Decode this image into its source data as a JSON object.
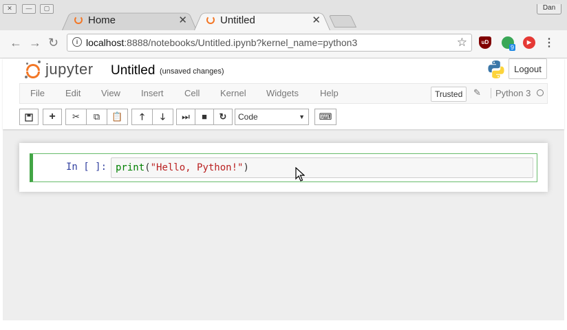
{
  "browser": {
    "profile_label": "Dan",
    "tabs": [
      {
        "title": "Home",
        "close": "✕"
      },
      {
        "title": "Untitled",
        "close": "✕"
      }
    ],
    "address": {
      "host": "localhost",
      "path": ":8888/notebooks/Untitled.ipynb?kernel_name=python3"
    },
    "extensions": [
      {
        "icon": "ublock-icon",
        "label": "uD",
        "color": "#800000"
      },
      {
        "icon": "green-extension-icon",
        "badge": "9",
        "color": "#3aa757"
      },
      {
        "icon": "video-extension-icon",
        "color": "#e53935"
      }
    ]
  },
  "jupyter": {
    "wordmark": "jupyter",
    "notebook_title": "Untitled",
    "autosave_status": "(unsaved changes)",
    "logout_label": "Logout",
    "menu": [
      "File",
      "Edit",
      "View",
      "Insert",
      "Cell",
      "Kernel",
      "Widgets",
      "Help"
    ],
    "trusted_label": "Trusted",
    "kernel_name": "Python 3",
    "cell_type": "Code",
    "cell": {
      "prompt": "In [ ]:",
      "code_fn": "print",
      "code_open": "(",
      "code_str": "\"Hello, Python!\"",
      "code_close": ")"
    }
  },
  "colors": {
    "jupyter_orange": "#f37726",
    "cell_border": "#42a545",
    "prompt": "#303f9f"
  }
}
